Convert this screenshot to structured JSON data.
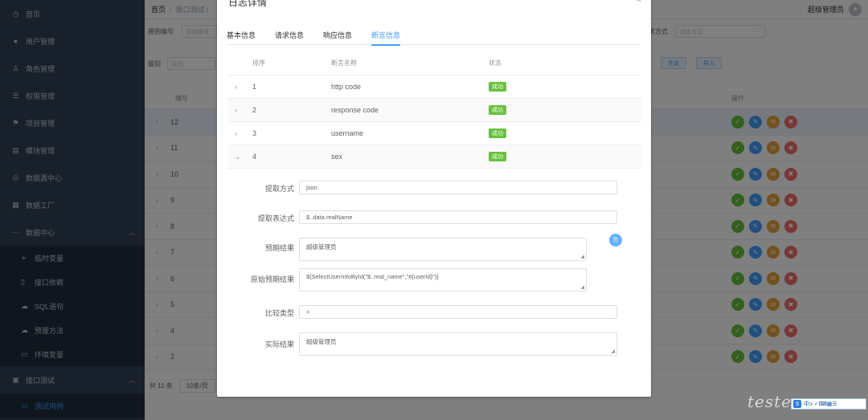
{
  "sidebar": {
    "items": [
      {
        "icon": "dashboard-icon",
        "label": "首页"
      },
      {
        "icon": "user-icon",
        "label": "用户管理"
      },
      {
        "icon": "role-icon",
        "label": "角色管理"
      },
      {
        "icon": "permission-icon",
        "label": "权限管理"
      },
      {
        "icon": "flag-icon",
        "label": "项目管理"
      },
      {
        "icon": "module-icon",
        "label": "模块管理"
      },
      {
        "icon": "database-icon",
        "label": "数据源中心"
      },
      {
        "icon": "factory-icon",
        "label": "数据工厂"
      },
      {
        "icon": "more-icon",
        "label": "数据中心"
      }
    ],
    "sub_items": [
      {
        "icon": "send-icon",
        "label": "临时变量"
      },
      {
        "icon": "phone-icon",
        "label": "接口依赖"
      },
      {
        "icon": "cloud-icon",
        "label": "SQL语句"
      },
      {
        "icon": "cloud-icon",
        "label": "预置方法"
      },
      {
        "icon": "folder-icon",
        "label": "环境变量"
      }
    ],
    "api_test": {
      "icon": "calendar-icon",
      "label": "接口测试"
    },
    "test_case": {
      "icon": "folder-icon",
      "label": "测试用例"
    }
  },
  "navbar": {
    "crumb_home": "首页",
    "crumb_sep": "/",
    "crumb_current": "接口测试 /",
    "user_name": "超级管理员"
  },
  "filter": {
    "case_no_label": "用例编号",
    "case_no_placeholder": "用例编号",
    "level_label": "级别",
    "level_placeholder": "级别",
    "method_label": "求方式",
    "method_placeholder": "请求方式",
    "generate_label": "生成",
    "import_label": "导入"
  },
  "table": {
    "col_no": "编号",
    "col_ops": "操作",
    "rows": [
      "12",
      "11",
      "10",
      "9",
      "8",
      "7",
      "6",
      "5",
      "4",
      "2"
    ],
    "highlight_row": 0
  },
  "pager": {
    "total": "共 11 条",
    "size": "10条/页"
  },
  "dialog": {
    "title": "日志详情",
    "close": "×",
    "tabs": [
      "基本信息",
      "请求信息",
      "响应信息",
      "断言信息"
    ],
    "active_tab": 3,
    "assert_table": {
      "col_no": "排序",
      "col_name": "断言名称",
      "col_status": "状态",
      "rows": [
        {
          "no": "1",
          "name": "http code",
          "status": "成功",
          "expanded": false
        },
        {
          "no": "2",
          "name": "response code",
          "status": "成功",
          "expanded": false
        },
        {
          "no": "3",
          "name": "username",
          "status": "成功",
          "expanded": false
        },
        {
          "no": "4",
          "name": "sex",
          "status": "成功",
          "expanded": true
        }
      ]
    },
    "detail": {
      "extract_method_label": "提取方式",
      "extract_method_value": "json",
      "extract_expr_label": "提取表达式",
      "extract_expr_value": "$..data.realName",
      "expected_label": "预期结果",
      "expected_value": "超级管理员",
      "raw_expected_label": "原始预期结果",
      "raw_expected_value": "${SelectUserInfoById(\"$..real_name\",\"#{userId}\")}",
      "compare_label": "比较类型",
      "compare_value": "=",
      "actual_label": "实际结果",
      "actual_value": "超级管理员"
    }
  },
  "watermark": "teste",
  "ime_bar": "中ɔ·✓⌨▦☰"
}
